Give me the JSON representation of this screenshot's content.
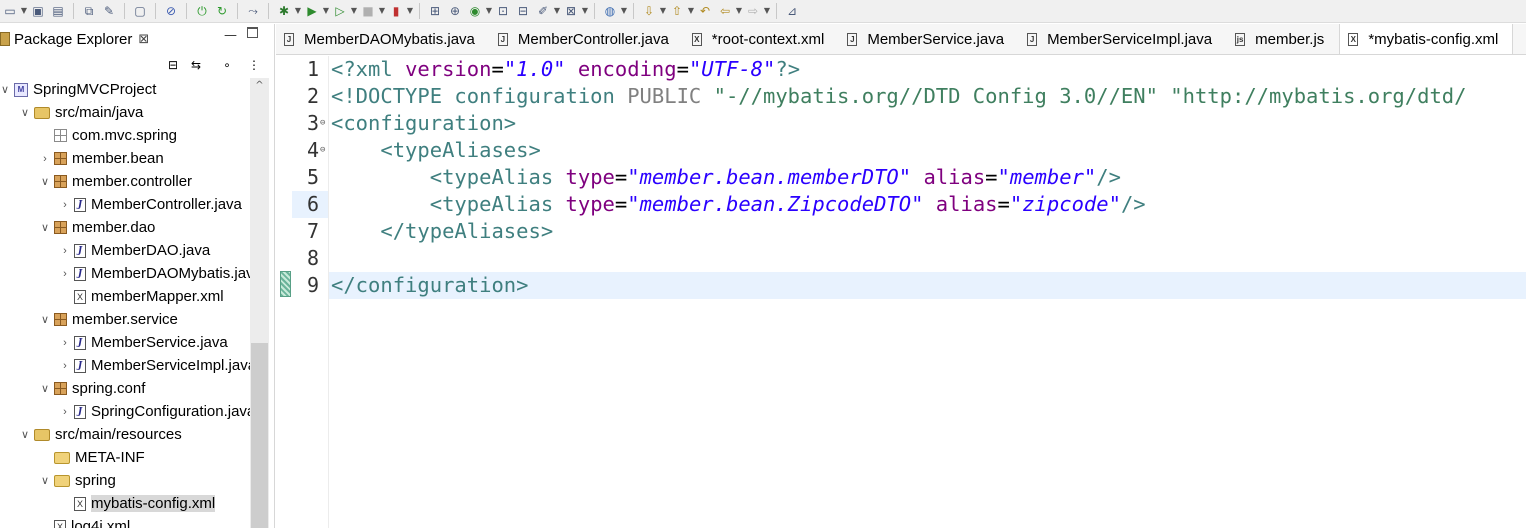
{
  "toolbar": {
    "icons": [
      "new-icon",
      "save-icon",
      "save-all-icon",
      "open-type-icon",
      "open-task-icon",
      "console-icon",
      "toggle-breakpoint-icon",
      "power-icon",
      "refresh-icon",
      "skip-icon",
      "debug-icon",
      "run-icon",
      "run-external-icon",
      "stop-icon",
      "coverage-icon",
      "new-java-project-icon",
      "new-package-icon",
      "new-class-icon",
      "open-folder-icon",
      "open-file-icon",
      "task-icon",
      "open-resource-icon",
      "globe-icon",
      "next-annotation-icon",
      "previous-annotation-icon",
      "last-edit-icon",
      "back-icon",
      "forward-icon",
      "perspective-icon"
    ]
  },
  "explorer": {
    "title": "Package Explorer",
    "close_glyph": "⊠",
    "min_glyph": "—"
  },
  "tree": [
    {
      "label": "SpringMVCProject",
      "depth": 0,
      "chevron": "∨",
      "icon": "project"
    },
    {
      "label": "src/main/java",
      "depth": 1,
      "chevron": "∨",
      "icon": "srcfolder"
    },
    {
      "label": "com.mvc.spring",
      "depth": 2,
      "chevron": "",
      "icon": "emptypkg"
    },
    {
      "label": "member.bean",
      "depth": 2,
      "chevron": "›",
      "icon": "package"
    },
    {
      "label": "member.controller",
      "depth": 2,
      "chevron": "∨",
      "icon": "package"
    },
    {
      "label": "MemberController.java",
      "depth": 3,
      "chevron": "›",
      "icon": "java"
    },
    {
      "label": "member.dao",
      "depth": 2,
      "chevron": "∨",
      "icon": "package"
    },
    {
      "label": "MemberDAO.java",
      "depth": 3,
      "chevron": "›",
      "icon": "java"
    },
    {
      "label": "MemberDAOMybatis.java",
      "depth": 3,
      "chevron": "›",
      "icon": "java"
    },
    {
      "label": "memberMapper.xml",
      "depth": 3,
      "chevron": "",
      "icon": "xml"
    },
    {
      "label": "member.service",
      "depth": 2,
      "chevron": "∨",
      "icon": "package"
    },
    {
      "label": "MemberService.java",
      "depth": 3,
      "chevron": "›",
      "icon": "java"
    },
    {
      "label": "MemberServiceImpl.java",
      "depth": 3,
      "chevron": "›",
      "icon": "java"
    },
    {
      "label": "spring.conf",
      "depth": 2,
      "chevron": "∨",
      "icon": "package"
    },
    {
      "label": "SpringConfiguration.java",
      "depth": 3,
      "chevron": "›",
      "icon": "java"
    },
    {
      "label": "src/main/resources",
      "depth": 1,
      "chevron": "∨",
      "icon": "srcfolder"
    },
    {
      "label": "META-INF",
      "depth": 2,
      "chevron": "",
      "icon": "folder"
    },
    {
      "label": "spring",
      "depth": 2,
      "chevron": "∨",
      "icon": "folder"
    },
    {
      "label": "mybatis-config.xml",
      "depth": 3,
      "chevron": "",
      "icon": "xml",
      "selected": true
    },
    {
      "label": "log4j.xml",
      "depth": 2,
      "chevron": "",
      "icon": "xml"
    }
  ],
  "tabs": [
    {
      "label": "MemberDAOMybatis.java",
      "icon": "J",
      "active": false
    },
    {
      "label": "MemberController.java",
      "icon": "J",
      "active": false
    },
    {
      "label": "*root-context.xml",
      "icon": "X",
      "active": false
    },
    {
      "label": "MemberService.java",
      "icon": "J",
      "active": false
    },
    {
      "label": "MemberServiceImpl.java",
      "icon": "J",
      "active": false
    },
    {
      "label": "member.js",
      "icon": "js",
      "active": false
    },
    {
      "label": "*mybatis-config.xml",
      "icon": "X",
      "active": true
    }
  ],
  "editor": {
    "current_line": 9,
    "fold_lines": [
      3,
      4
    ],
    "lines": [
      {
        "n": "1",
        "tokens": [
          [
            "pi",
            "<?xml "
          ],
          [
            "attr",
            "version"
          ],
          [
            "txt",
            "="
          ],
          [
            "val",
            "\"1.0\""
          ],
          [
            "txt",
            " "
          ],
          [
            "attr",
            "encoding"
          ],
          [
            "txt",
            "="
          ],
          [
            "val",
            "\"UTF-8\""
          ],
          [
            "pi",
            "?>"
          ]
        ]
      },
      {
        "n": "2",
        "tokens": [
          [
            "decl",
            "<!DOCTYPE configuration "
          ],
          [
            "kw",
            "PUBLIC "
          ],
          [
            "str",
            "\"-//mybatis.org//DTD Config 3.0//EN\" \"http://mybatis.org/dtd/"
          ]
        ]
      },
      {
        "n": "3",
        "tokens": [
          [
            "tag",
            "<configuration>"
          ]
        ]
      },
      {
        "n": "4",
        "tokens": [
          [
            "txt",
            "    "
          ],
          [
            "tag",
            "<typeAliases>"
          ]
        ]
      },
      {
        "n": "5",
        "tokens": [
          [
            "txt",
            "        "
          ],
          [
            "tag",
            "<typeAlias "
          ],
          [
            "attr",
            "type"
          ],
          [
            "txt",
            "="
          ],
          [
            "val",
            "\"member.bean.memberDTO\""
          ],
          [
            "txt",
            " "
          ],
          [
            "attr",
            "alias"
          ],
          [
            "txt",
            "="
          ],
          [
            "val",
            "\"member\""
          ],
          [
            "tag",
            "/>"
          ]
        ]
      },
      {
        "n": "6",
        "tokens": [
          [
            "txt",
            "        "
          ],
          [
            "tag",
            "<typeAlias "
          ],
          [
            "attr",
            "type"
          ],
          [
            "txt",
            "="
          ],
          [
            "val",
            "\"member.bean.ZipcodeDTO\""
          ],
          [
            "txt",
            " "
          ],
          [
            "attr",
            "alias"
          ],
          [
            "txt",
            "="
          ],
          [
            "val",
            "\"zipcode\""
          ],
          [
            "tag",
            "/>"
          ]
        ]
      },
      {
        "n": "7",
        "tokens": [
          [
            "txt",
            "    "
          ],
          [
            "tag",
            "</typeAliases>"
          ]
        ]
      },
      {
        "n": "8",
        "tokens": []
      },
      {
        "n": "9",
        "tokens": [
          [
            "tag",
            "</configuration>"
          ]
        ]
      }
    ]
  }
}
